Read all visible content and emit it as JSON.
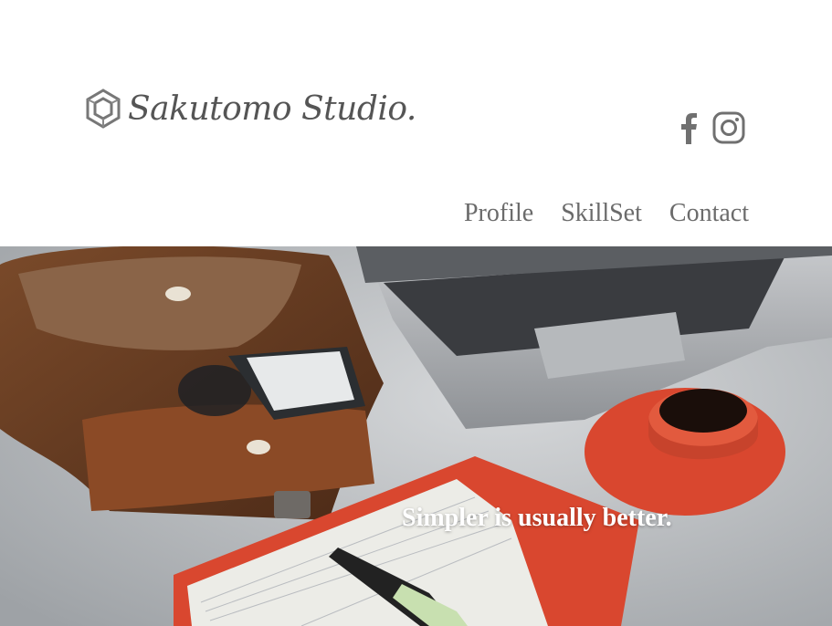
{
  "brand": {
    "name": "Sakutomo Studio.",
    "logo_icon": "hexagon-logo-mark"
  },
  "social": [
    {
      "name": "facebook",
      "icon": "facebook-icon"
    },
    {
      "name": "instagram",
      "icon": "instagram-icon"
    }
  ],
  "nav": {
    "items": [
      "Profile",
      "SkillSet",
      "Contact"
    ]
  },
  "hero": {
    "tagline": "Simpler is usually better."
  },
  "colors": {
    "text_gray": "#6b6b6b",
    "hero_red": "#d9472f"
  }
}
